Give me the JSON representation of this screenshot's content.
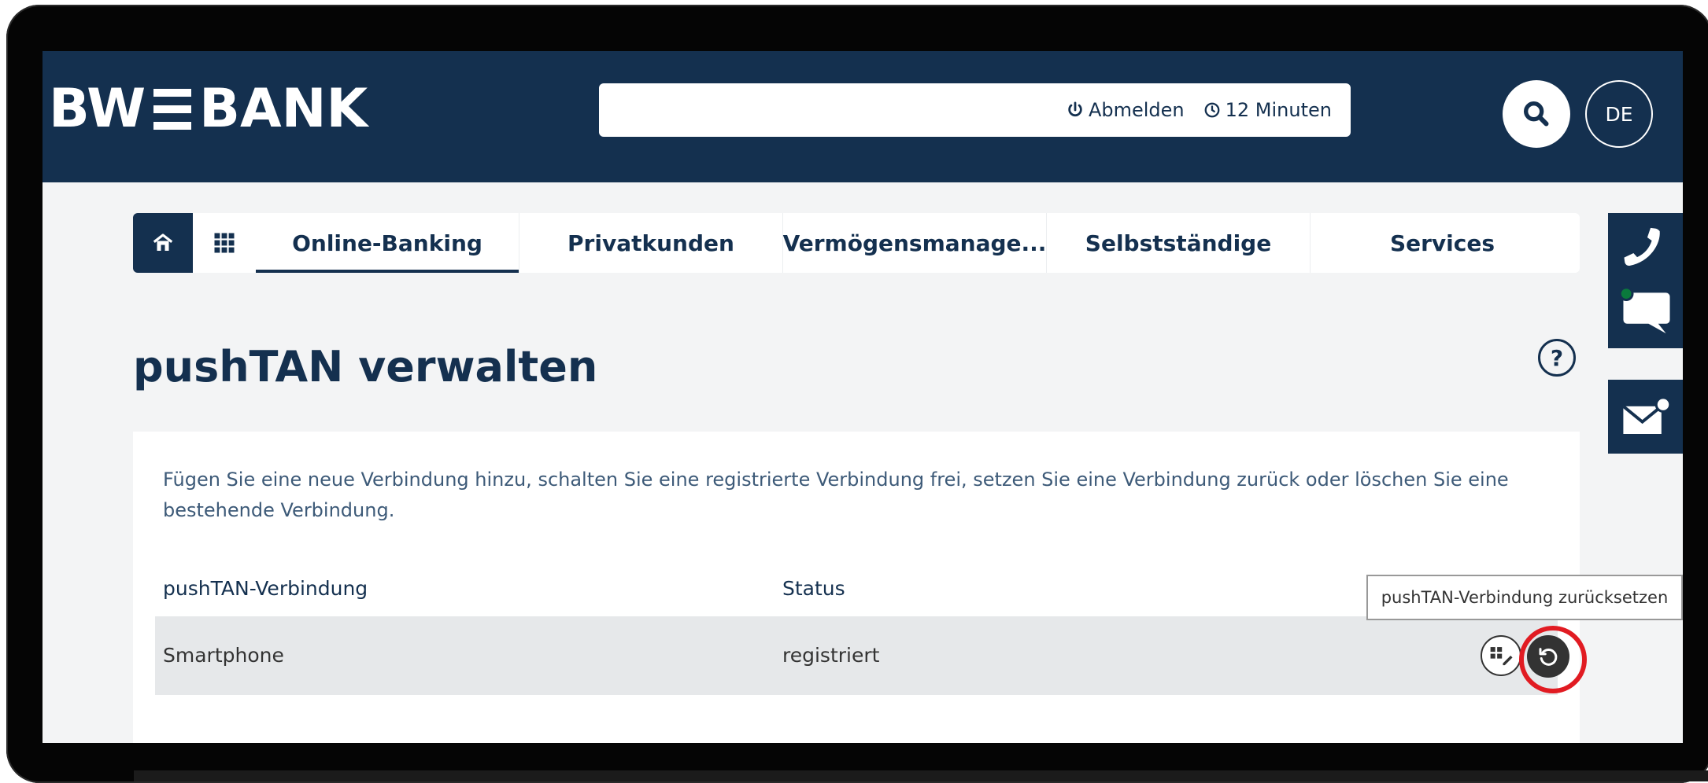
{
  "brand": {
    "logo_left": "BW",
    "logo_right": "BANK"
  },
  "session": {
    "logout_label": "Abmelden",
    "timer_label": "12 Minuten"
  },
  "header": {
    "language": "DE"
  },
  "nav": {
    "tabs": [
      {
        "label": "Online-Banking",
        "active": true
      },
      {
        "label": "Privatkunden"
      },
      {
        "label": "Vermögensmanage..."
      },
      {
        "label": "Selbstständige"
      },
      {
        "label": "Services"
      }
    ]
  },
  "page": {
    "title": "pushTAN verwalten",
    "help": "?",
    "description": "Fügen Sie eine neue Verbindung hinzu, schalten Sie eine registrierte Verbindung frei, setzen Sie eine Verbindung zurück oder löschen Sie eine bestehende Verbindung."
  },
  "table": {
    "columns": [
      "pushTAN-Verbindung",
      "Status"
    ],
    "rows": [
      {
        "connection": "Smartphone",
        "status": "registriert"
      }
    ]
  },
  "tooltip": {
    "text": "pushTAN-Verbindung zurücksetzen"
  },
  "colors": {
    "primary": "#14304f",
    "highlight": "#e11b22",
    "status_dot": "#0a7a3c"
  },
  "icons": [
    "power-icon",
    "clock-icon",
    "search-icon",
    "home-icon",
    "apps-grid-icon",
    "phone-icon",
    "chat-icon",
    "mail-icon",
    "qr-edit-icon",
    "reset-icon"
  ]
}
